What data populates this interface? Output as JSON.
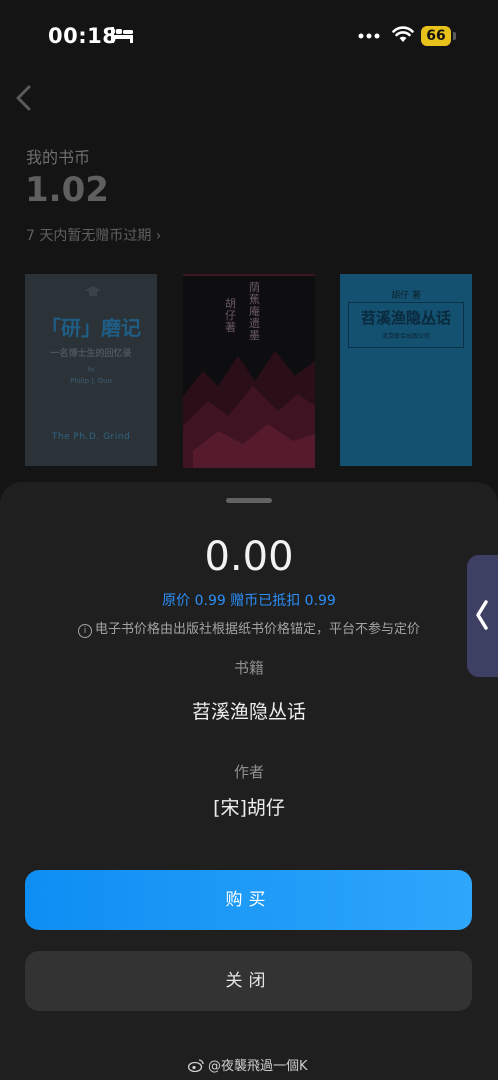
{
  "status_bar": {
    "time": "00:18",
    "battery": "66"
  },
  "background": {
    "coins_title": "我的书币",
    "coins_value": "1.02",
    "coins_expire": "7 天内暂无赠币过期 ›",
    "covers": [
      {
        "title": "「研」磨记",
        "subtitle": "一名博士生的回忆录",
        "by": "by",
        "author": "Philip J. Guo",
        "series": "The Ph.D. Grind"
      },
      {
        "title": "荫蕉庵遗墨",
        "author": "胡仔 著"
      },
      {
        "author": "胡仔 著",
        "title": "苕溪渔隐丛话",
        "publisher": "北京联合出版公司"
      }
    ]
  },
  "sheet": {
    "price": "0.00",
    "original_price": "原价 0.99 赠币已抵扣 0.99",
    "notice": "电子书价格由出版社根据纸书价格锚定，平台不参与定价",
    "book_label": "书籍",
    "book_value": "苕溪渔隐丛话",
    "author_label": "作者",
    "author_value": "[宋]胡仔",
    "buy_label": "购买",
    "close_label": "关闭"
  },
  "watermark": "@夜襲飛過一個K",
  "colors": {
    "accent": "#1a96f7",
    "sheet_bg": "#1f1f1f",
    "page_bg": "#141414"
  },
  "icons": [
    "bed-icon",
    "more-dots-icon",
    "wifi-icon",
    "back-icon",
    "info-icon",
    "chevron-left-icon",
    "weibo-icon"
  ]
}
